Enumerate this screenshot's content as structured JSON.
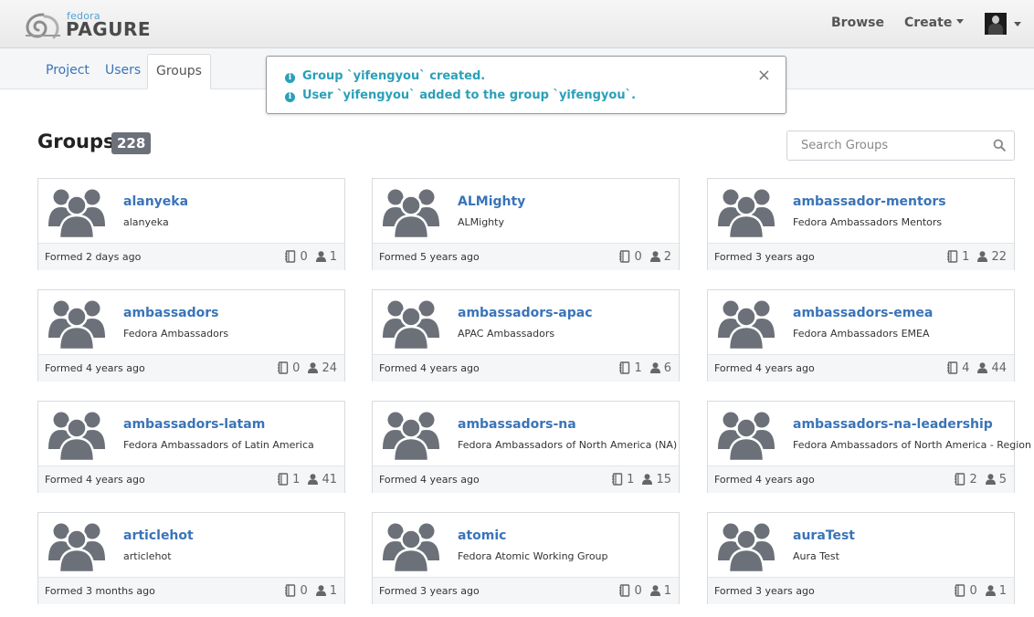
{
  "header": {
    "logo_small": "fedora",
    "logo_main": "PAGURE",
    "browse_label": "Browse",
    "create_label": "Create"
  },
  "tabs": [
    {
      "label": "Project"
    },
    {
      "label": "Users"
    },
    {
      "label": "Groups",
      "active": true
    }
  ],
  "alert": {
    "messages": [
      "Group `yifengyou` created.",
      "User `yifengyou` added to the group `yifengyou`."
    ],
    "close_symbol": "×"
  },
  "page": {
    "title": "Groups",
    "count": "228",
    "search_placeholder": "Search Groups"
  },
  "groups": [
    {
      "name": "alanyeka",
      "description": "alanyeka",
      "formed": "Formed 2 days ago",
      "projects": "0",
      "members": "1"
    },
    {
      "name": "ALMighty",
      "description": "ALMighty",
      "formed": "Formed 5 years ago",
      "projects": "0",
      "members": "2"
    },
    {
      "name": "ambassador-mentors",
      "description": "Fedora Ambassadors Mentors",
      "formed": "Formed 3 years ago",
      "projects": "1",
      "members": "22"
    },
    {
      "name": "ambassadors",
      "description": "Fedora Ambassadors",
      "formed": "Formed 4 years ago",
      "projects": "0",
      "members": "24"
    },
    {
      "name": "ambassadors-apac",
      "description": "APAC Ambassadors",
      "formed": "Formed 4 years ago",
      "projects": "1",
      "members": "6"
    },
    {
      "name": "ambassadors-emea",
      "description": "Fedora Ambassadors EMEA",
      "formed": "Formed 4 years ago",
      "projects": "4",
      "members": "44"
    },
    {
      "name": "ambassadors-latam",
      "description": "Fedora Ambassadors of Latin America",
      "formed": "Formed 4 years ago",
      "projects": "1",
      "members": "41"
    },
    {
      "name": "ambassadors-na",
      "description": "Fedora Ambassadors of North America (NA)",
      "formed": "Formed 4 years ago",
      "projects": "1",
      "members": "15"
    },
    {
      "name": "ambassadors-na-leadership",
      "description": "Fedora Ambassadors of North America - Region lea",
      "formed": "Formed 4 years ago",
      "projects": "2",
      "members": "5"
    },
    {
      "name": "articlehot",
      "description": "articlehot",
      "formed": "Formed 3 months ago",
      "projects": "0",
      "members": "1"
    },
    {
      "name": "atomic",
      "description": "Fedora Atomic Working Group",
      "formed": "Formed 3 years ago",
      "projects": "0",
      "members": "1"
    },
    {
      "name": "auraTest",
      "description": "Aura Test",
      "formed": "Formed 3 years ago",
      "projects": "0",
      "members": "1"
    }
  ],
  "icons": {
    "group": "group-users-icon",
    "projects": "project-book-icon",
    "members": "user-icon",
    "search": "search-icon",
    "info": "info-circle-icon",
    "logo": "pagure-snail-logo-icon"
  },
  "colors": {
    "link": "#3a74b8",
    "alert_text": "#2aa0b8",
    "badge_bg": "#6b7079",
    "group_icon": "#6b7079"
  }
}
